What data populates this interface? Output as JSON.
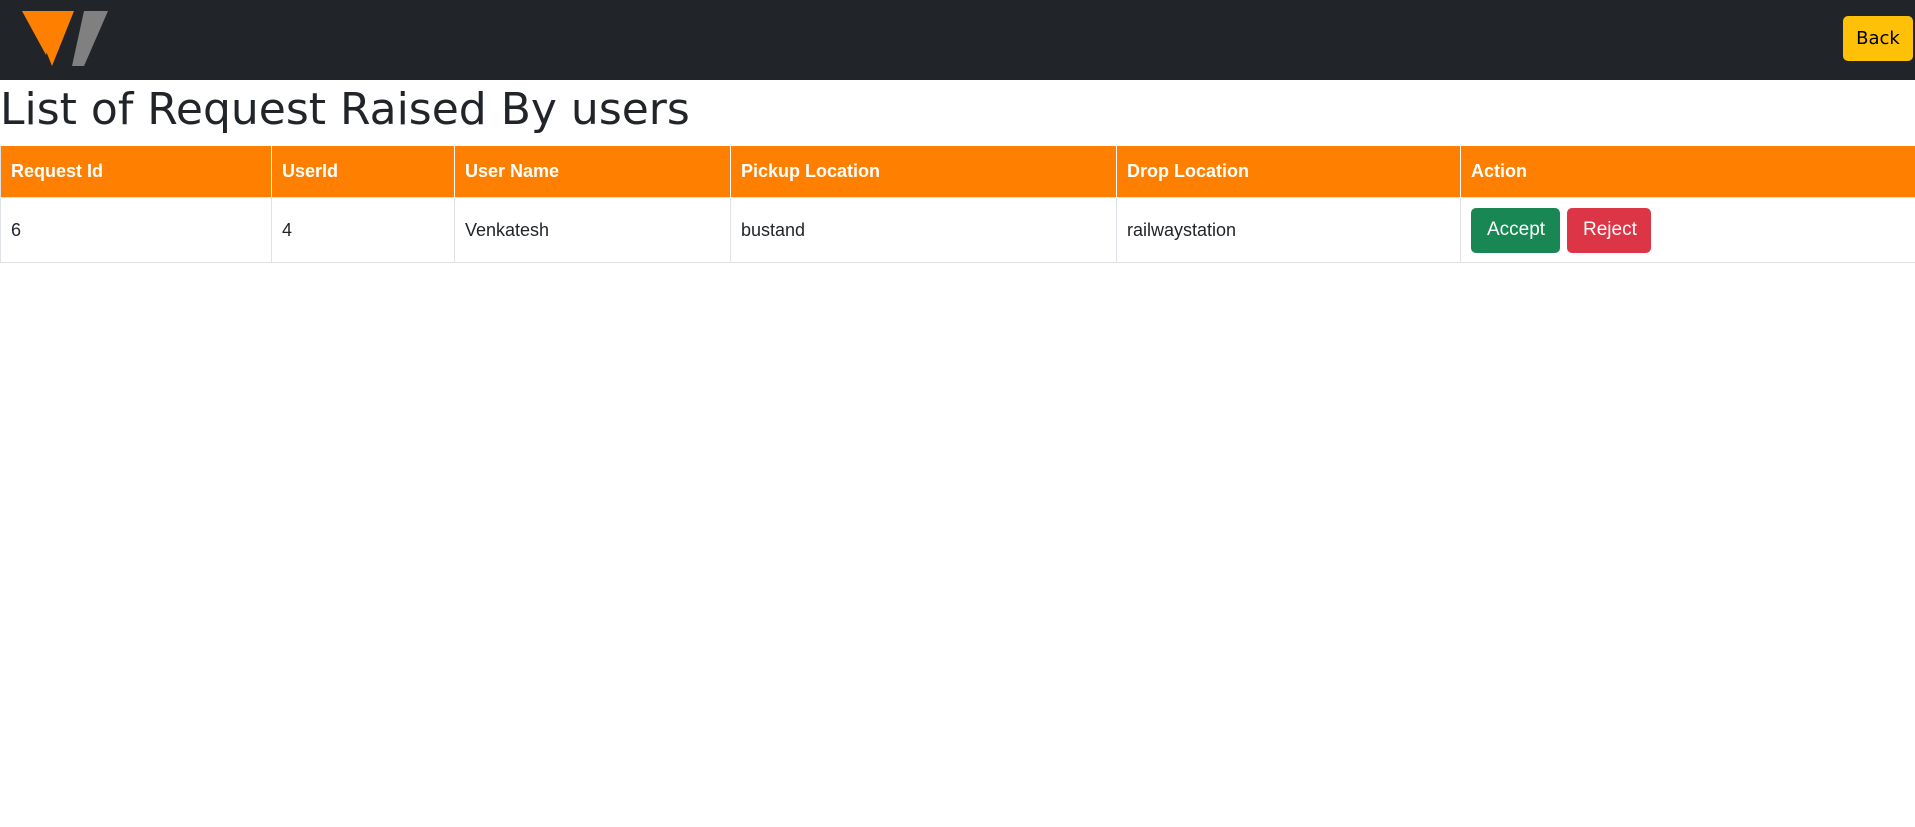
{
  "navbar": {
    "logo_icon": "v-chevron-logo",
    "back_label": "Back",
    "brand_colors": {
      "primary": "#ff8000",
      "secondary": "#808080",
      "back_button": "#ffc107"
    }
  },
  "page": {
    "title": "List of Request Raised By users"
  },
  "table": {
    "header_color": "#ff8000",
    "columns": [
      "Request Id",
      "UserId",
      "User Name",
      "Pickup Location",
      "Drop Location",
      "Action"
    ],
    "rows": [
      {
        "request_id": "6",
        "user_id": "4",
        "user_name": "Venkatesh",
        "pickup_location": "bustand",
        "drop_location": "railwaystation",
        "accept_label": "Accept",
        "reject_label": "Reject"
      }
    ]
  },
  "status_colors": {
    "accept": "#198754",
    "reject": "#dc3545"
  }
}
